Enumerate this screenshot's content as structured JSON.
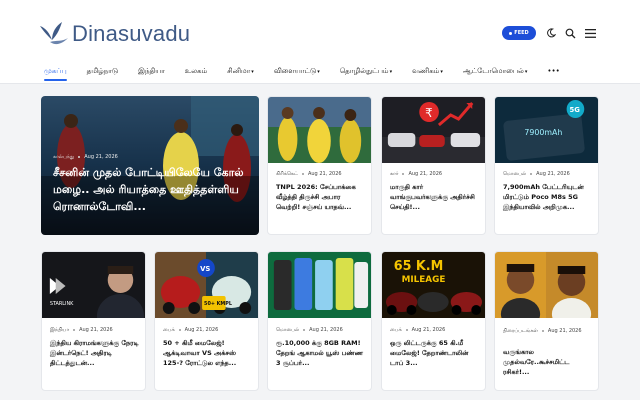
{
  "brand": {
    "name": "Dinasuvadu"
  },
  "header": {
    "feed_label": "FEED"
  },
  "icons": {
    "theme": "moon-icon",
    "search": "search-icon",
    "menu": "hamburger-icon"
  },
  "nav": [
    {
      "label": "முகப்பு",
      "active": true
    },
    {
      "label": "தமிழ்நாடு"
    },
    {
      "label": "இந்தியா"
    },
    {
      "label": "உலகம்"
    },
    {
      "label": "சினிமா"
    },
    {
      "label": "விளையாட்டு"
    },
    {
      "label": "தொழில்நுட்பம்"
    },
    {
      "label": "வணிகம்"
    },
    {
      "label": "ஆட்டோமொபைல்"
    },
    {
      "label": "•••"
    }
  ],
  "hero": {
    "category": "கால்பந்து",
    "date": "Aug 21, 2026",
    "title": "சீசனின் முதல் போட்டியிலேயே கோல் மழை.. அல் ரியாத்தை ஊதித்தள்ளிய ரொனால்டோவி..."
  },
  "row1": [
    {
      "category": "கிரிக்கெட்",
      "date": "Aug 21, 2026",
      "title": "TNPL 2026: சேப்பாக்கை வீழ்த்தி திருச்சி அபார வெற்றி! சஞ்சய் யாதவ்..."
    },
    {
      "category": "கார்",
      "date": "Aug 21, 2026",
      "title": "மாருதி கார் வாங்குபவர்களுக்கு அதிர்ச்சி செய்தி!..."
    },
    {
      "category": "மொபைல்",
      "date": "Aug 21, 2026",
      "title": "7,900mAh பேட்டரியுடன் மிரட்டும் Poco M8s 5G இந்தியாவில் அறிமுக..."
    }
  ],
  "row2": [
    {
      "category": "இந்தியா",
      "date": "Aug 21, 2026",
      "title": "இந்திய கிராமங்களுக்கு நேரடி இன்டர்நெட்! அதிரடி திட்டத்துடன்..."
    },
    {
      "category": "பைக்",
      "date": "Aug 21, 2026",
      "title": "50 + கிமீ மைலேஜ்! ஆக்டிவாவா VS அக்சஸ் 125-? ரோட்டுல எந்த..."
    },
    {
      "category": "மொபைல்",
      "date": "Aug 21, 2026",
      "title": "ரூ.10,000 க்கு 8GB RAM! தேறங் ஆகாமல் யூஸ் பண்ண 3 சூப்பர்..."
    },
    {
      "category": "பைக்",
      "date": "Aug 21, 2026",
      "title": "ஒரு லிட்டருக்கு 65 கி.மீ மைலேஜ்! தேறாண்டாலின் டாப் 3..."
    },
    {
      "category": "திரைப்படங்கள்",
      "date": "Aug 21, 2026",
      "title": "வருங்கால முதல்வரே..கூச்சமிட்ட ரசிகர்!..."
    }
  ],
  "thumb_texts": {
    "starlink": "STARLINK",
    "vs": "VS",
    "kmpl": "50+ KMPL",
    "mileage_num": "65 K.M",
    "mileage_word": "MILEAGE",
    "battery": "7900mAh",
    "phone_5g": "5G"
  }
}
